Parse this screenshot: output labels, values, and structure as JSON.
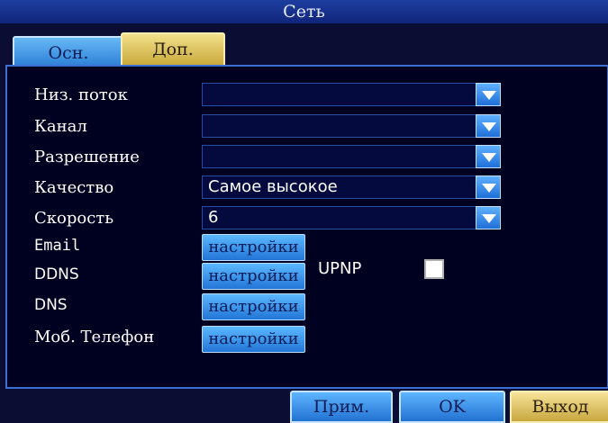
{
  "window": {
    "title": "Сеть"
  },
  "tabs": [
    {
      "label": "Осн."
    },
    {
      "label": "Доп."
    }
  ],
  "rows": [
    {
      "label": "Низ. поток",
      "value": ""
    },
    {
      "label": "Канал",
      "value": ""
    },
    {
      "label": "Разрешение",
      "value": ""
    },
    {
      "label": "Качество",
      "value": "Самое высокое"
    },
    {
      "label": "Скорость",
      "value": "6"
    }
  ],
  "settings_rows": [
    {
      "label": "Email",
      "button": "настройки"
    },
    {
      "label": "DDNS",
      "button": "настройки"
    },
    {
      "label": "DNS",
      "button": "настройки"
    },
    {
      "label": "Моб. Телефон",
      "button": "настройки"
    }
  ],
  "upnp": {
    "label": "UPNP",
    "checked": false
  },
  "footer": {
    "apply": "Прим.",
    "ok": "OK",
    "exit": "Выход"
  },
  "colors": {
    "background": "#0b0d33",
    "accent_blue": "#2c7fd6",
    "accent_yellow": "#c9a93c"
  },
  "icons": {
    "dropdown": "chevron-down-icon"
  }
}
